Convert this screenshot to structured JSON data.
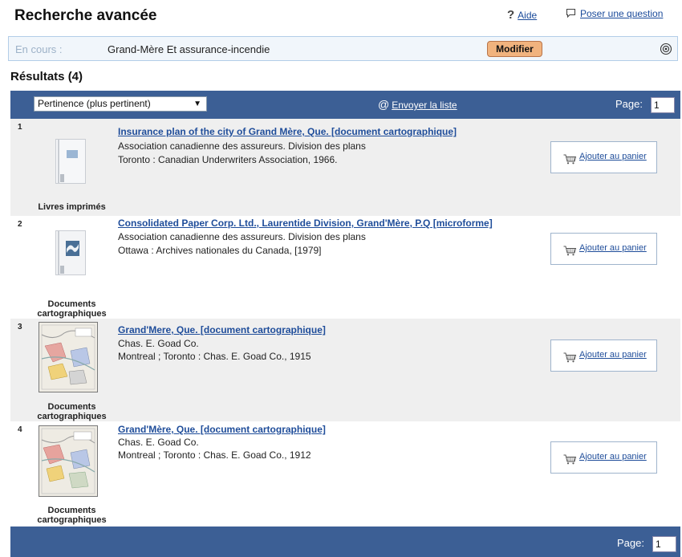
{
  "header": {
    "title": "Recherche avancée",
    "help_label": "Aide",
    "ask_label": "Poser une question"
  },
  "current": {
    "label": "En cours :",
    "query": "Grand-Mère Et assurance-incendie",
    "modify_label": "Modifier"
  },
  "results_title": "Résultats (4)",
  "toolbar": {
    "sort_value": "Pertinence (plus pertinent)",
    "send_list_label": "Envoyer la liste",
    "page_label": "Page:",
    "page_value": "1"
  },
  "cart_label": "Ajouter au panier",
  "results": [
    {
      "num": "1",
      "title": "Insurance plan of the city of Grand Mère, Que. [document cartographique]",
      "author": "Association canadienne des assureurs. Division des plans",
      "publication": "Toronto : Canadian Underwriters Association, 1966.",
      "doc_type": "Livres imprimés"
    },
    {
      "num": "2",
      "title": "Consolidated Paper Corp. Ltd., Laurentide Division, Grand'Mère, P.Q [microforme]",
      "author": "Association canadienne des assureurs. Division des plans",
      "publication": "Ottawa : Archives nationales du Canada, [1979]",
      "doc_type": "Documents cartographiques"
    },
    {
      "num": "3",
      "title": "Grand'Mere, Que. [document cartographique]",
      "author": "Chas. E. Goad Co.",
      "publication": "Montreal ; Toronto : Chas. E. Goad Co., 1915",
      "doc_type": "Documents cartographiques"
    },
    {
      "num": "4",
      "title": "Grand'Mère, Que. [document cartographique]",
      "author": "Chas. E. Goad Co.",
      "publication": "Montreal ; Toronto : Chas. E. Goad Co., 1912",
      "doc_type": "Documents cartographiques"
    }
  ],
  "colors": {
    "toolbar": "#3c5f95",
    "link": "#1f4d9a",
    "modify_button": "#f1b37e",
    "current_box_bg": "#f1f6fb"
  }
}
